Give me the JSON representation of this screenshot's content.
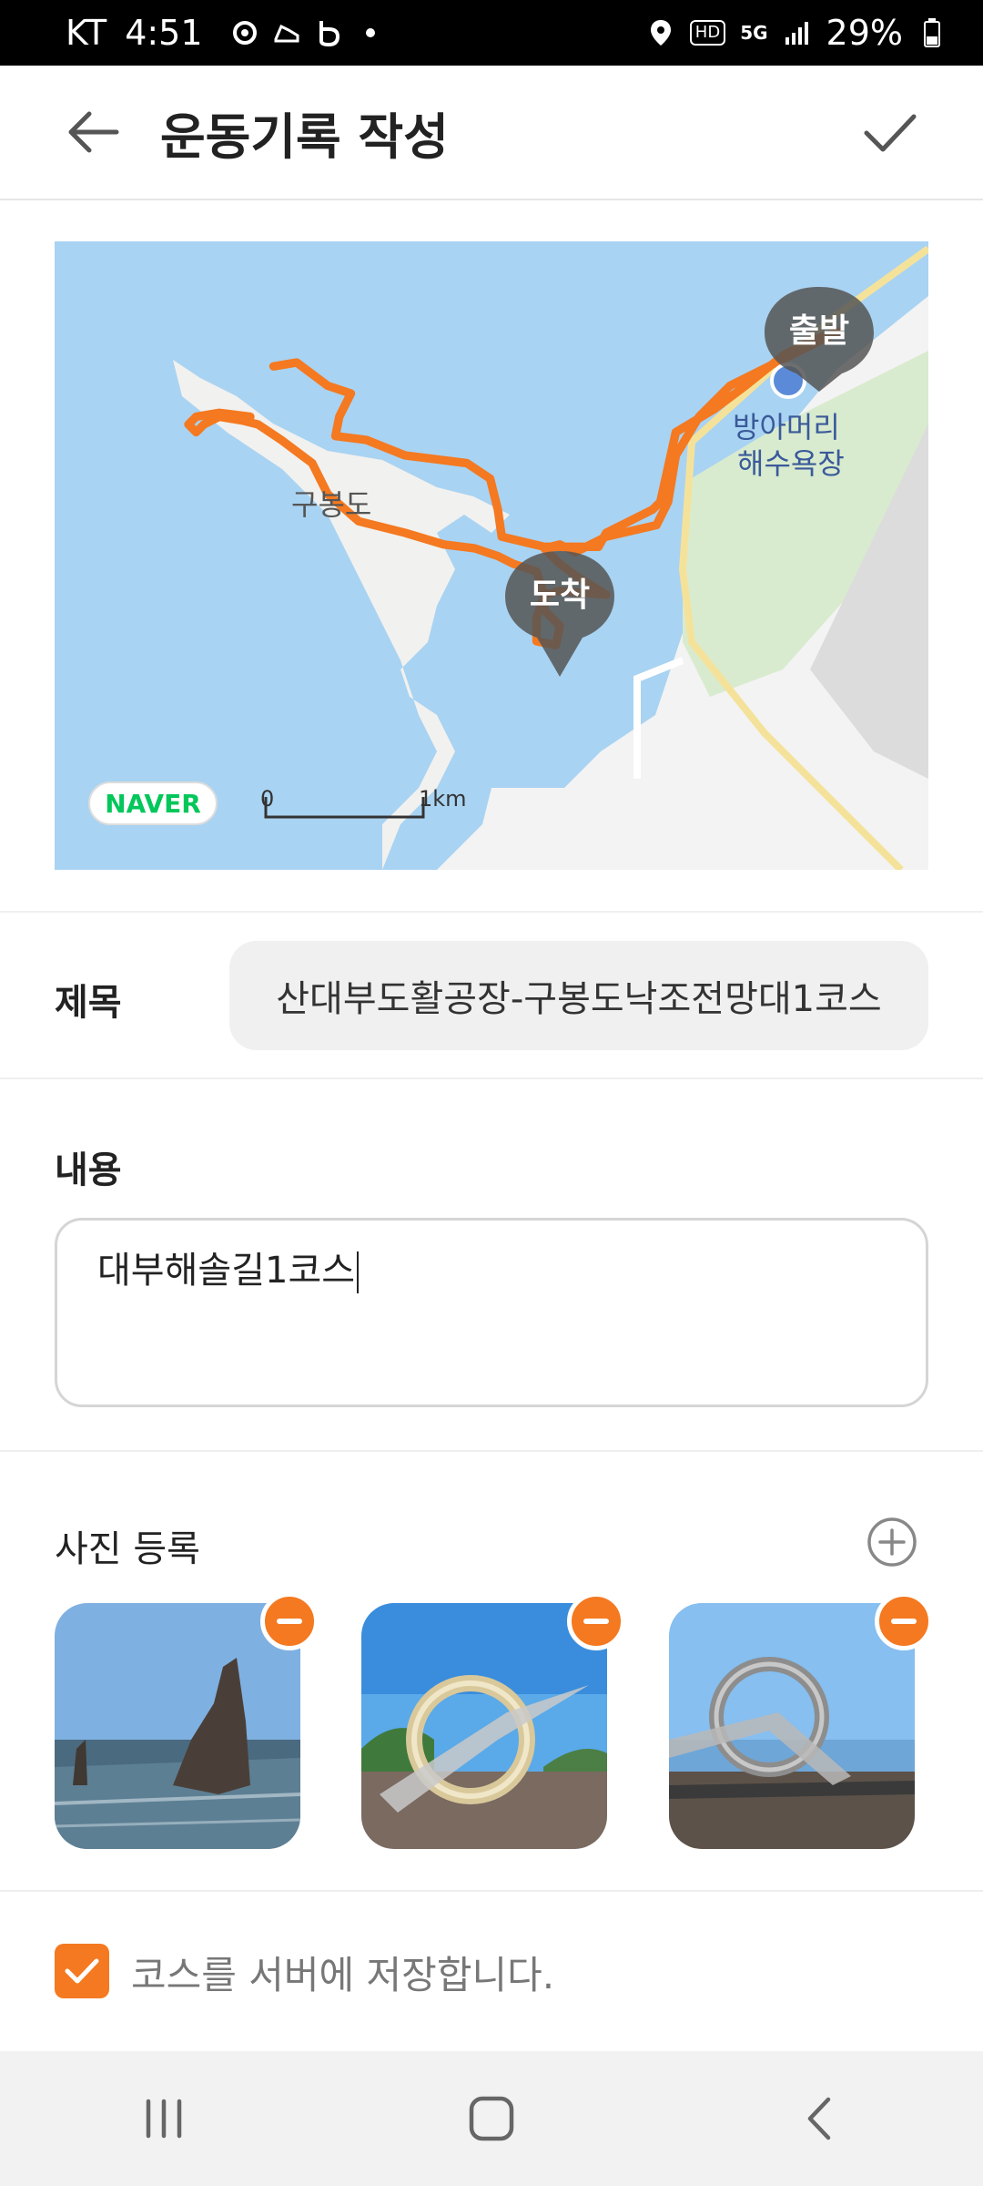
{
  "status_bar": {
    "carrier": "KT",
    "time": "4:51",
    "network": "5G",
    "hd": "HD",
    "battery": "29%"
  },
  "app_bar": {
    "title": "운동기록 작성",
    "back_icon": "arrow-left-icon",
    "confirm_icon": "check-icon"
  },
  "map": {
    "start_label": "출발",
    "end_label": "도착",
    "island_label": "구봉도",
    "beach_label_line1": "방아머리",
    "beach_label_line2": "해수욕장",
    "provider": "NAVER",
    "scale_zero": "0",
    "scale_km": "1km",
    "route_color": "#f47920",
    "water_color": "#a9d3f2"
  },
  "form": {
    "title_label": "제목",
    "title_value": "산대부도활공장-구봉도낙조전망대1코스",
    "content_label": "내용",
    "content_value": "대부해솔길1코스"
  },
  "photos": {
    "section_label": "사진 등록",
    "add_icon": "plus-circle-icon",
    "remove_icon": "minus-circle-icon",
    "items": [
      {
        "subject": "rock-sea"
      },
      {
        "subject": "ring-sculpture"
      },
      {
        "subject": "ring-sculpture-wide"
      }
    ]
  },
  "save_course": {
    "checked": true,
    "label": "코스를 서버에 저장합니다."
  },
  "nav_bar": {
    "recents_icon": "recents-icon",
    "home_icon": "home-icon",
    "back_icon": "nav-back-icon"
  },
  "colors": {
    "accent": "#f47920",
    "field_bg": "#f0f0f0",
    "border": "#d5d5d5"
  }
}
